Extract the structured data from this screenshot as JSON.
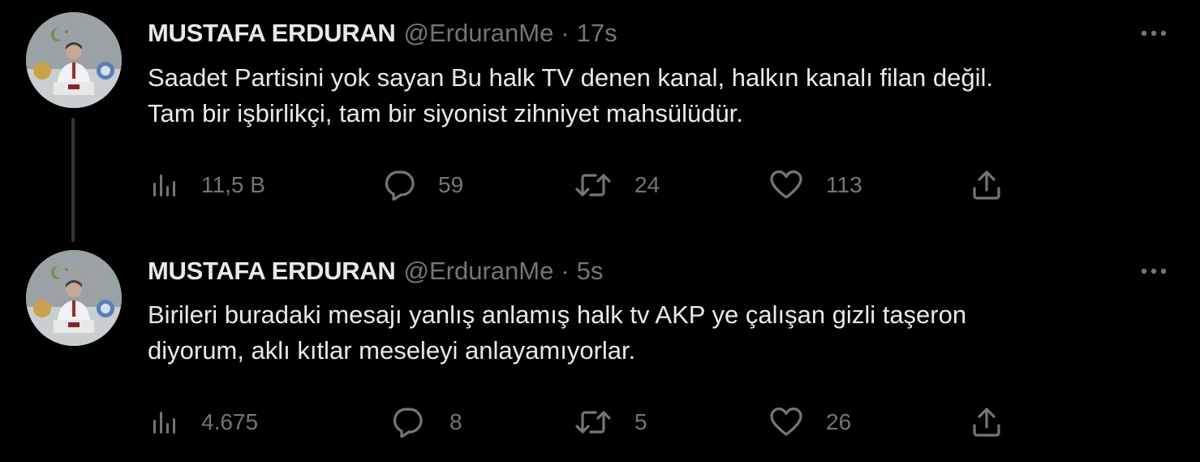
{
  "tweets": [
    {
      "author": {
        "name": "MUSTAFA ERDURAN",
        "handle": "@ErduranMe",
        "avatar_icon": "profile-photo"
      },
      "separator": "·",
      "time": "17s",
      "text_lines": [
        "Saadet Partisini yok sayan Bu halk TV denen kanal, halkın kanalı filan değil.",
        "Tam bir işbirlikçi, tam bir siyonist zihniyet mahsülüdür."
      ],
      "stats": {
        "views": "11,5 B",
        "replies": "59",
        "retweets": "24",
        "likes": "113"
      }
    },
    {
      "author": {
        "name": "MUSTAFA ERDURAN",
        "handle": "@ErduranMe",
        "avatar_icon": "profile-photo"
      },
      "separator": "·",
      "time": "5s",
      "text_lines": [
        "Birileri buradaki mesajı yanlış anlamış halk tv AKP ye çalışan gizli taşeron",
        "diyorum, aklı kıtlar meseleyi anlayamıyorlar."
      ],
      "stats": {
        "views": "4.675",
        "replies": "8",
        "retweets": "5",
        "likes": "26"
      }
    }
  ],
  "icons": {
    "views": "analytics-icon",
    "reply": "reply-icon",
    "retweet": "retweet-icon",
    "like": "heart-icon",
    "share": "share-icon",
    "more": "more-icon"
  },
  "colors": {
    "background": "#000000",
    "text_primary": "#e7e9ea",
    "text_secondary": "#71767b",
    "thread_line": "#333639"
  }
}
